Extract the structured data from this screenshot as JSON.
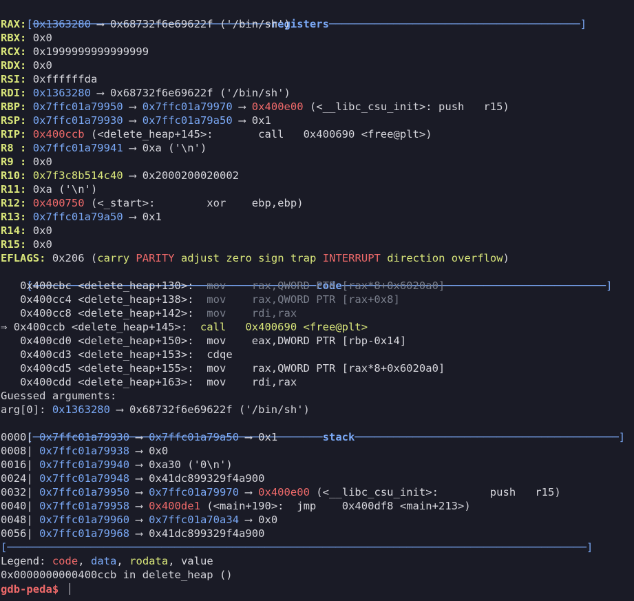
{
  "terminal": {
    "registers_title": "registers",
    "code_title": "code",
    "stack_title": "stack",
    "registers": [
      {
        "name": "RAX:",
        "val": "0x1363280",
        "cls": "b",
        "rest": " ⟶ 0x68732f6e69622f ('/bin/sh')"
      },
      {
        "name": "RBX:",
        "val": "",
        "cls": "w",
        "rest": " 0x0"
      },
      {
        "name": "RCX:",
        "val": "",
        "cls": "w",
        "rest": " 0x1999999999999999"
      },
      {
        "name": "RDX:",
        "val": "",
        "cls": "w",
        "rest": " 0x0"
      },
      {
        "name": "RSI:",
        "val": "",
        "cls": "w",
        "rest": " 0xffffffda"
      },
      {
        "name": "RDI:",
        "val": "0x1363280",
        "cls": "b",
        "rest": " ⟶ 0x68732f6e69622f ('/bin/sh')"
      }
    ],
    "rbp": {
      "name": "RBP:",
      "a": "0x7ffc01a79950",
      "b": "0x7ffc01a79970",
      "c": "0x400e00",
      "rest": " (<__libc_csu_init>: push   r15)"
    },
    "rsp": {
      "name": "RSP:",
      "a": "0x7ffc01a79930",
      "b": "0x7ffc01a79a50",
      "rest": " ⟶ 0x1"
    },
    "rip": {
      "name": "RIP:",
      "a": "0x400ccb",
      "rest": " (<delete_heap+145>:       call   0x400690 <free@plt>)"
    },
    "r8": {
      "name": "R8 :",
      "a": "0x7ffc01a79941",
      "rest": " ⟶ 0xa ('\\n')"
    },
    "r9": {
      "name": "R9 :",
      "rest": " 0x0"
    },
    "r10": {
      "name": "R10:",
      "a": "0x7f3c8b514c40",
      "rest": " ⟶ 0x2000200020002"
    },
    "r11": {
      "name": "R11:",
      "rest": " 0xa ('\\n')"
    },
    "r12": {
      "name": "R12:",
      "a": "0x400750",
      "rest": " (<_start>:        xor    ebp,ebp)"
    },
    "r13": {
      "name": "R13:",
      "a": "0x7ffc01a79a50",
      "rest": " ⟶ 0x1"
    },
    "r14": {
      "name": "R14:",
      "rest": " 0x0"
    },
    "r15": {
      "name": "R15:",
      "rest": " 0x0"
    },
    "eflags": {
      "name": "EFLAGS:",
      "val": " 0x206 (",
      "flags": [
        {
          "t": "carry",
          "cls": "y"
        },
        {
          "t": " ",
          "cls": "w"
        },
        {
          "t": "PARITY",
          "cls": "r"
        },
        {
          "t": " ",
          "cls": "w"
        },
        {
          "t": "adjust",
          "cls": "y"
        },
        {
          "t": " ",
          "cls": "w"
        },
        {
          "t": "zero",
          "cls": "y"
        },
        {
          "t": " ",
          "cls": "w"
        },
        {
          "t": "sign",
          "cls": "y"
        },
        {
          "t": " ",
          "cls": "w"
        },
        {
          "t": "trap",
          "cls": "y"
        },
        {
          "t": " ",
          "cls": "w"
        },
        {
          "t": "INTERRUPT",
          "cls": "r"
        },
        {
          "t": " ",
          "cls": "w"
        },
        {
          "t": "direction",
          "cls": "y"
        },
        {
          "t": " ",
          "cls": "w"
        },
        {
          "t": "overflow",
          "cls": "y"
        }
      ],
      "close": ")"
    },
    "code": [
      {
        "prefix": "   ",
        "addr": "0x400cbc <delete_heap+130>:  ",
        "op": "mov    ",
        "args": "rax,QWORD PTR [rax*8+0x6020a0]",
        "cls": "d"
      },
      {
        "prefix": "   ",
        "addr": "0x400cc4 <delete_heap+138>:  ",
        "op": "mov    ",
        "args": "rax,QWORD PTR [rax+0x8]",
        "cls": "d"
      },
      {
        "prefix": "   ",
        "addr": "0x400cc8 <delete_heap+142>:  ",
        "op": "mov    ",
        "args": "rdi,rax",
        "cls": "d"
      },
      {
        "prefix": "⇒ ",
        "addr": "0x400ccb <delete_heap+145>:  ",
        "op": "call   ",
        "args": "0x400690 <free@plt>",
        "cls": "cur"
      },
      {
        "prefix": "   ",
        "addr": "0x400cd0 <delete_heap+150>:  ",
        "op": "mov    ",
        "args": "eax,DWORD PTR [rbp-0x14]",
        "cls": "w"
      },
      {
        "prefix": "   ",
        "addr": "0x400cd3 <delete_heap+153>:  ",
        "op": "cdqe",
        "args": "",
        "cls": "w"
      },
      {
        "prefix": "   ",
        "addr": "0x400cd5 <delete_heap+155>:  ",
        "op": "mov    ",
        "args": "rax,QWORD PTR [rax*8+0x6020a0]",
        "cls": "w"
      },
      {
        "prefix": "   ",
        "addr": "0x400cdd <delete_heap+163>:  ",
        "op": "mov    ",
        "args": "rdi,rax",
        "cls": "w"
      }
    ],
    "guessed": "Guessed arguments:",
    "arg0": {
      "name": "arg[0]:",
      "a": "0x1363280",
      "rest": " ⟶ 0x68732f6e69622f ('/bin/sh')"
    },
    "stack": [
      {
        "off": "0000|",
        "a": "0x7ffc01a79930",
        "p1": " ⟶ ",
        "b": "0x7ffc01a79a50",
        "bcls": "b",
        "p2": " ⟶ 0x1",
        "c": "",
        "rest": ""
      },
      {
        "off": "0008|",
        "a": "0x7ffc01a79938",
        "p1": " ⟶ 0x0",
        "b": "",
        "bcls": "b",
        "p2": "",
        "c": "",
        "rest": ""
      },
      {
        "off": "0016|",
        "a": "0x7ffc01a79940",
        "p1": " ⟶ 0xa30 ('0\\n')",
        "b": "",
        "bcls": "b",
        "p2": "",
        "c": "",
        "rest": ""
      },
      {
        "off": "0024|",
        "a": "0x7ffc01a79948",
        "p1": " ⟶ 0x41dc899329f4a900",
        "b": "",
        "bcls": "b",
        "p2": "",
        "c": "",
        "rest": ""
      },
      {
        "off": "0032|",
        "a": "0x7ffc01a79950",
        "p1": " ⟶ ",
        "b": "0x7ffc01a79970",
        "bcls": "b",
        "p2": " ⟶ ",
        "c": "0x400e00",
        "rest": " (<__libc_csu_init>:        push   r15)"
      },
      {
        "off": "0040|",
        "a": "0x7ffc01a79958",
        "p1": " ⟶ ",
        "b": "0x400de1",
        "bcls": "r",
        "p2": " (<main+190>:  jmp    0x400df8 <main+213>)",
        "c": "",
        "rest": ""
      },
      {
        "off": "0048|",
        "a": "0x7ffc01a79960",
        "p1": " ⟶ ",
        "b": "0x7ffc01a70a34",
        "bcls": "b",
        "p2": " ⟶ 0x0",
        "c": "",
        "rest": ""
      },
      {
        "off": "0056|",
        "a": "0x7ffc01a79968",
        "p1": " ⟶ 0x41dc899329f4a900",
        "b": "",
        "bcls": "b",
        "p2": "",
        "c": "",
        "rest": ""
      }
    ],
    "legend": {
      "label": "Legend: ",
      "code": "code",
      "s1": ", ",
      "data": "data",
      "s2": ", ",
      "rodata": "rodata",
      "s3": ", ",
      "value": "value"
    },
    "location": "0x0000000000400ccb in delete_heap ()",
    "prompt": "gdb-peda$ "
  }
}
